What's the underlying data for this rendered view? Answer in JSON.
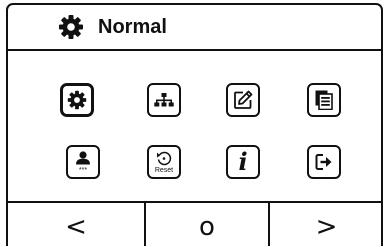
{
  "header": {
    "title": "Normal",
    "icon": "gear-icon"
  },
  "menu": {
    "items": [
      {
        "id": "settings",
        "icon": "gear-icon",
        "label": "",
        "selected": true
      },
      {
        "id": "network",
        "icon": "network-tree-icon",
        "label": "",
        "selected": false
      },
      {
        "id": "edit",
        "icon": "edit-icon",
        "label": "",
        "selected": false
      },
      {
        "id": "records",
        "icon": "document-list-icon",
        "label": "",
        "selected": false
      },
      {
        "id": "user-password",
        "icon": "user-password-icon",
        "label": "***",
        "selected": false
      },
      {
        "id": "reset",
        "icon": "reset-icon",
        "label": "Reset",
        "selected": false
      },
      {
        "id": "info",
        "icon": "info-icon",
        "label": "i",
        "selected": false
      },
      {
        "id": "exit",
        "icon": "exit-icon",
        "label": "",
        "selected": false
      }
    ]
  },
  "navbar": {
    "prev": "<",
    "home": "o",
    "next": ">"
  }
}
